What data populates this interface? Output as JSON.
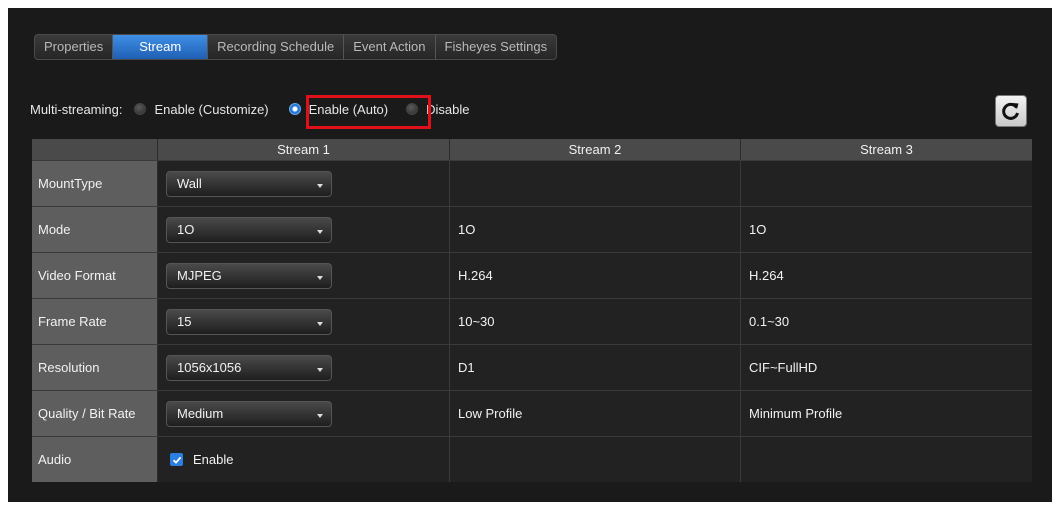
{
  "tabs": [
    "Properties",
    "Stream",
    "Recording Schedule",
    "Event Action",
    "Fisheyes Settings"
  ],
  "active_tab": "Stream",
  "multistreaming": {
    "label": "Multi-streaming:",
    "options": [
      "Enable (Customize)",
      "Enable (Auto)",
      "Disable"
    ],
    "selected": "Enable (Auto)"
  },
  "table": {
    "headers": [
      "",
      "Stream 1",
      "Stream 2",
      "Stream 3"
    ],
    "rows": [
      {
        "label": "MountType",
        "s1": "Wall",
        "s2": "",
        "s3": ""
      },
      {
        "label": "Mode",
        "s1": "1O",
        "s2": "1O",
        "s3": "1O"
      },
      {
        "label": "Video Format",
        "s1": "MJPEG",
        "s2": "H.264",
        "s3": "H.264"
      },
      {
        "label": "Frame Rate",
        "s1": "15",
        "s2": "10~30",
        "s3": "0.1~30"
      },
      {
        "label": "Resolution",
        "s1": "1056x1056",
        "s2": "D1",
        "s3": "CIF~FullHD"
      },
      {
        "label": "Quality / Bit Rate",
        "s1": "Medium",
        "s2": "Low Profile",
        "s3": "Minimum Profile"
      },
      {
        "label": "Audio",
        "s1": "Enable",
        "s2": "",
        "s3": ""
      }
    ]
  },
  "icons": {
    "refresh": "refresh-icon",
    "dropdown": "chevron-down-icon",
    "check": "checkmark-icon"
  },
  "colors": {
    "accent": "#2b7fe0",
    "highlight": "#e0101a",
    "label_bg": "#5e5e5e",
    "cell_bg": "#222222"
  }
}
